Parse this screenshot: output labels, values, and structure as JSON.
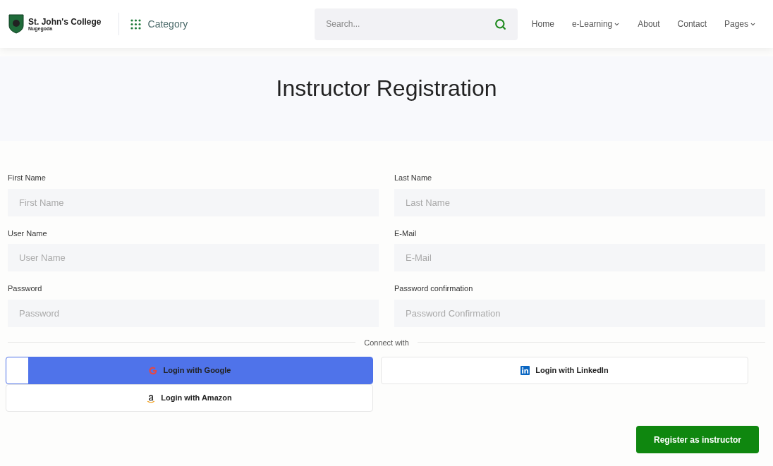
{
  "header": {
    "brand": {
      "name": "St. John's College",
      "subtitle": "Nugegoda"
    },
    "category": "Category",
    "search": {
      "placeholder": "Search..."
    },
    "nav": [
      {
        "label": "Home",
        "dropdown": false
      },
      {
        "label": "e-Learning",
        "dropdown": true
      },
      {
        "label": "About",
        "dropdown": false
      },
      {
        "label": "Contact",
        "dropdown": false
      },
      {
        "label": "Pages",
        "dropdown": true
      }
    ]
  },
  "title": "Instructor Registration",
  "fields": [
    {
      "label": "First Name",
      "placeholder": "First Name"
    },
    {
      "label": "Last Name",
      "placeholder": "Last Name"
    },
    {
      "label": "User Name",
      "placeholder": "User Name"
    },
    {
      "label": "E-Mail",
      "placeholder": "E-Mail"
    },
    {
      "label": "Password",
      "placeholder": "Password"
    },
    {
      "label": "Password confirmation",
      "placeholder": "Password Confirmation"
    }
  ],
  "connect_label": "Connect with",
  "social": [
    {
      "kind": "google",
      "label": "Login with Google",
      "highlighted": true
    },
    {
      "kind": "linkedin",
      "label": "Login with LinkedIn",
      "highlighted": false
    },
    {
      "kind": "amazon",
      "label": "Login with Amazon",
      "highlighted": false
    }
  ],
  "submit": "Register as instructor"
}
